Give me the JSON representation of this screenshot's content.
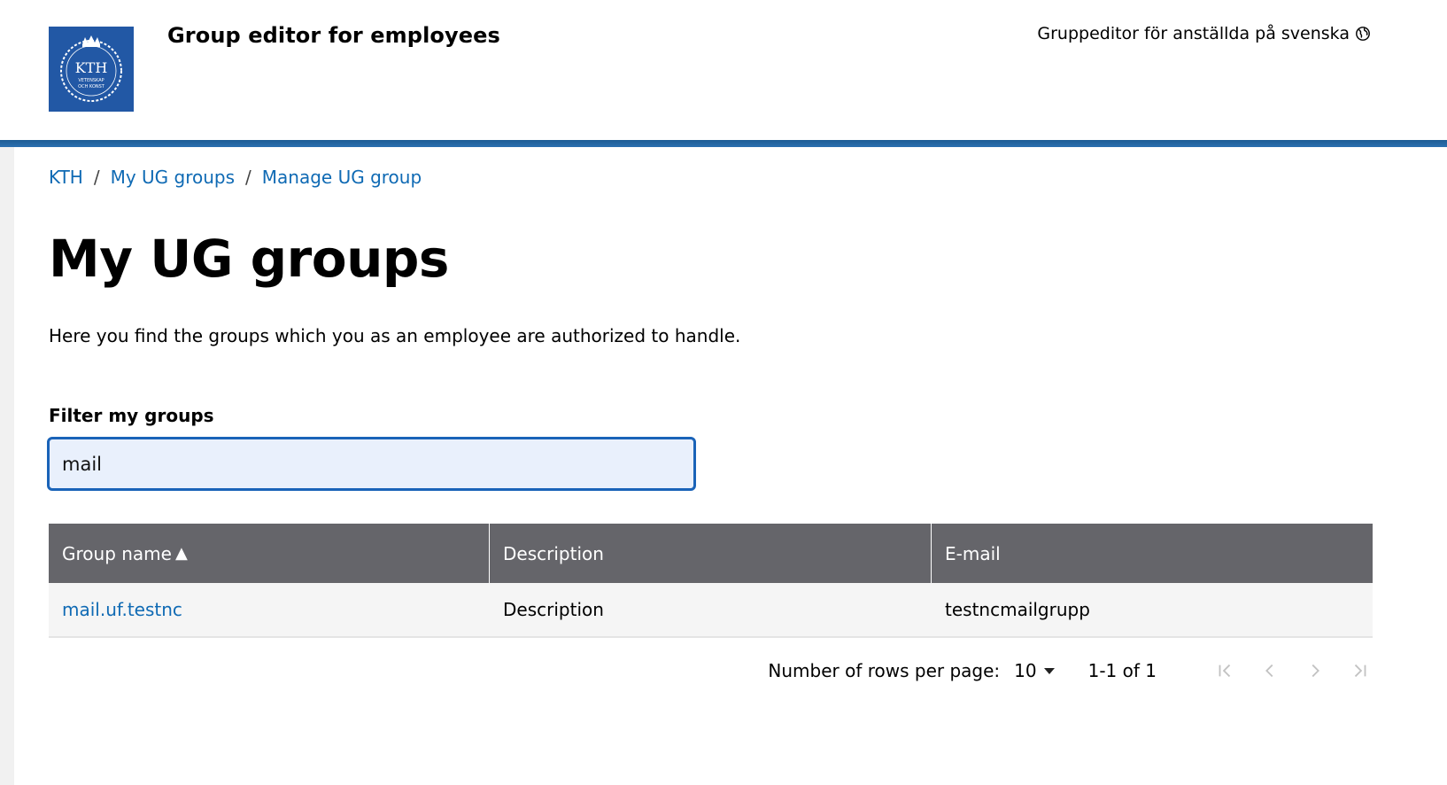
{
  "header": {
    "logo_text": "KTH",
    "logo_subtext_1": "VETENSKAP",
    "logo_subtext_2": "OCH KONST",
    "title": "Group editor for employees",
    "language_link": "Gruppeditor för anställda på svenska",
    "accent_color": "#2258a5"
  },
  "breadcrumb": {
    "items": [
      "KTH",
      "My UG groups",
      "Manage UG group"
    ],
    "separator": "/"
  },
  "main": {
    "title": "My UG groups",
    "intro": "Here you find the groups which you as an employee are authorized to handle.",
    "filter": {
      "label": "Filter my groups",
      "value": "mail"
    }
  },
  "table": {
    "columns": [
      "Group name",
      "Description",
      "E-mail"
    ],
    "sort_indicator": "▲",
    "rows": [
      {
        "name": "mail.uf.testnc",
        "description": "Description",
        "email": "testncmailgrupp"
      }
    ]
  },
  "pagination": {
    "rows_per_page_label": "Number of rows per page:",
    "rows_per_page_value": "10",
    "range": "1-1 of 1",
    "icons": [
      "first-page-icon",
      "previous-page-icon",
      "next-page-icon",
      "last-page-icon"
    ]
  }
}
